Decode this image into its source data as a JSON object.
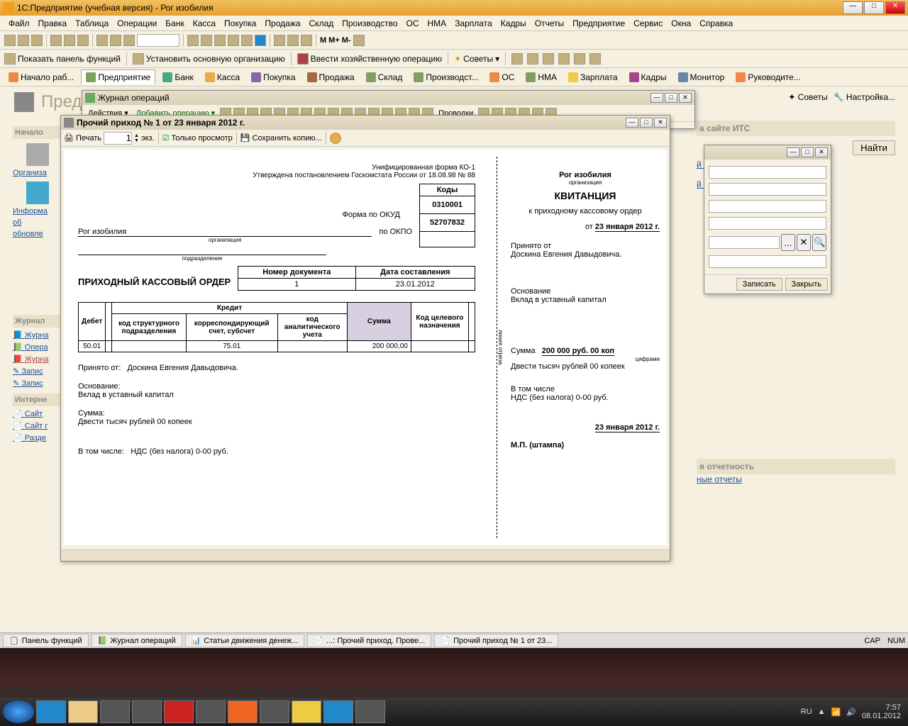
{
  "app_title": "1С:Предприятие (учебная версия) - Рог изобилия",
  "menu": [
    "Файл",
    "Правка",
    "Таблица",
    "Операции",
    "Банк",
    "Касса",
    "Покупка",
    "Продажа",
    "Склад",
    "Производство",
    "ОС",
    "НМА",
    "Зарплата",
    "Кадры",
    "Отчеты",
    "Предприятие",
    "Сервис",
    "Окна",
    "Справка"
  ],
  "toolbar2_links": [
    "Показать панель функций",
    "Установить основную организацию",
    "Ввести хозяйственную операцию",
    "Советы"
  ],
  "toolbar2_m": [
    "М",
    "М+",
    "М-"
  ],
  "navtabs": [
    "Начало раб...",
    "Предприятие",
    "Банк",
    "Касса",
    "Покупка",
    "Продажа",
    "Склад",
    "Производст...",
    "ОС",
    "НМА",
    "Зарплата",
    "Кадры",
    "Монитор",
    "Руководите..."
  ],
  "page_heading": "Пред",
  "left_sections": {
    "start": "Начало",
    "org": "Организа",
    "inform": [
      "Информа",
      "об",
      "обновле"
    ],
    "journal_head": "Журнал",
    "journals": [
      "Журна",
      "Опера",
      "Журна",
      "Запис",
      "Запис"
    ],
    "internet_head": "Интерне",
    "internet": [
      "Сайт",
      "Сайт г",
      "Разде"
    ]
  },
  "journal_window": {
    "title": "Журнал операций",
    "actions": [
      "Действия",
      "Добавить операцию",
      "Проводки"
    ]
  },
  "doc_window": {
    "title": "Прочий приход № 1 от 23 января 2012 г.",
    "print_btn": "Печать",
    "copies": "1",
    "copies_label": "экз.",
    "view_only": "Только просмотр",
    "save_copy": "Сохранить копию..."
  },
  "document": {
    "form_label": "Унифицированная форма КО-1",
    "approval": "Утверждена постановлением Госкомстата России от 18.08.98 № 88",
    "codes_header": "Коды",
    "okud_label": "Форма по ОКУД",
    "okud": "0310001",
    "okpo_label": "по ОКПО",
    "okpo": "52707832",
    "org_name": "Рог изобилия",
    "org_sublabel": "организация",
    "div_sublabel": "подразделение",
    "order_title": "ПРИХОДНЫЙ КАССОВЫЙ ОРДЕР",
    "doc_num_label": "Номер документа",
    "doc_num": "1",
    "doc_date_label": "Дата составления",
    "doc_date": "23.01.2012",
    "table_headers": {
      "debit": "Дебет",
      "credit": "Кредит",
      "sub1": "код структурного подразделения",
      "sub2": "корреспондирующий счет, субсчет",
      "sub3": "код аналитического учета",
      "sum": "Сумма",
      "purpose": "Код целевого назначения"
    },
    "debit_val": "50.01",
    "credit_acc": "75.01",
    "sum_val": "200 000,00",
    "received_from_label": "Принято от:",
    "received_from": "Доскина Евгения Давыдовича.",
    "basis_label": "Основание:",
    "basis": "Вклад в уставный капитал",
    "sum_label": "Сумма:",
    "sum_text": "Двести тысяч рублей 00 копеек",
    "including_label": "В том числе:",
    "including": "НДС (без налога) 0-00 руб.",
    "receipt_title": "КВИТАНЦИЯ",
    "receipt_sub": "к приходному кассовому ордер",
    "receipt_date_label": "от",
    "receipt_date": "23 января 2012 г.",
    "receipt_from_label": "Принято от",
    "receipt_from": "Доскина Евгения Давыдовича.",
    "receipt_basis_label": "Основание",
    "receipt_sum_label": "Сумма",
    "receipt_sum": "200 000 руб. 00 коп",
    "receipt_sum_sub": "цифрами",
    "receipt_sum_words": "Двести тысяч рублей 00 копеек",
    "receipt_incl_label": "В том числе",
    "receipt_incl": "НДС (без налога) 0-00 руб.",
    "receipt_date2": "23 января 2012 г.",
    "stamp": "М.П. (штампа)",
    "cut_label": "линия отреза"
  },
  "right_panel": {
    "its_head": "а сайте ИТС",
    "find_btn": "Найти",
    "tax": "й налога",
    "nds": "й НДС",
    "report_head": "я отчетность",
    "reports": "ные отчеты"
  },
  "dialog": {
    "clear": "✕",
    "search": "🔍",
    "write": "Записать",
    "close": "Закрыть"
  },
  "taskbar_windows": [
    "Панель функций",
    "Журнал операций",
    "Статьи движения денеж...",
    "...: Прочий приход. Прове...",
    "Прочий приход № 1 от 23..."
  ],
  "status_right": [
    "CAP",
    "NUM"
  ],
  "tray": {
    "lang": "RU",
    "time": "7:57",
    "date": "08.01.2012"
  },
  "help_links": [
    "Советы",
    "Настройка..."
  ]
}
